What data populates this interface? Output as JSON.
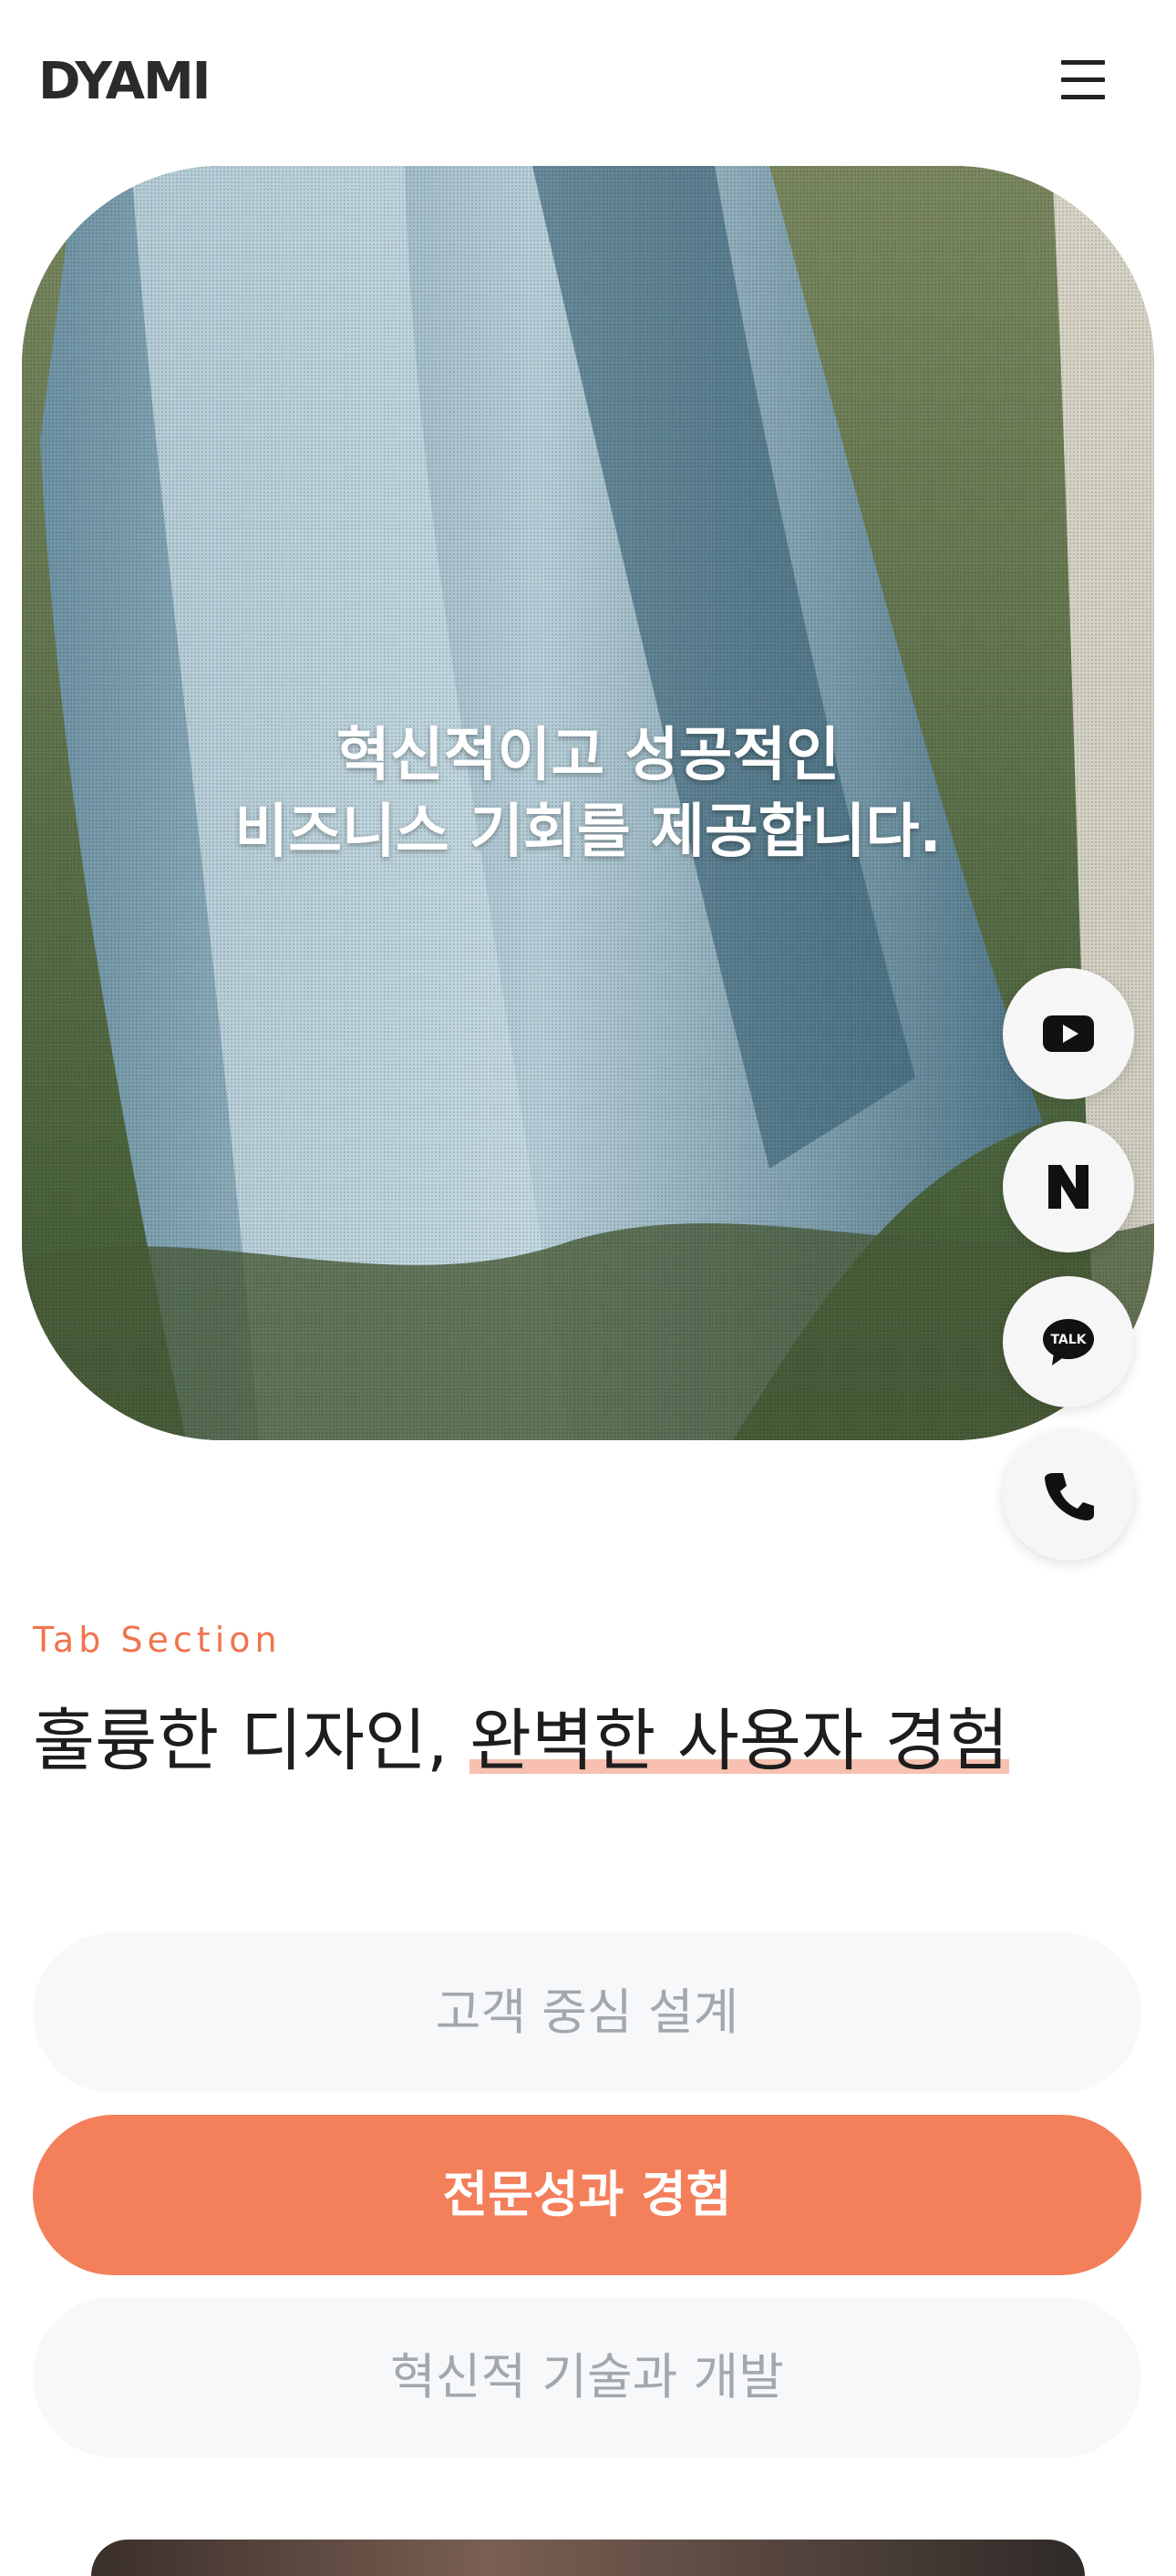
{
  "header": {
    "logo": "DYAMI",
    "menu_icon": "hamburger-menu-icon"
  },
  "hero": {
    "title_line1": "혁신적이고 성공적인",
    "title_line2": "비즈니스 기회를 제공합니다.",
    "slides_total": 2,
    "active_slide": 2
  },
  "floating_buttons": [
    {
      "icon": "youtube-icon"
    },
    {
      "icon": "naver-icon",
      "glyph": "N"
    },
    {
      "icon": "kakaotalk-icon",
      "glyph": "TALK"
    },
    {
      "icon": "phone-icon"
    }
  ],
  "section": {
    "eyebrow": "Tab Section",
    "title_plain": "훌륭한 디자인, ",
    "title_highlight": "완벽한 사용자 경험"
  },
  "tabs": [
    {
      "label": "고객 중심 설계",
      "active": false
    },
    {
      "label": "전문성과 경험",
      "active": true
    },
    {
      "label": "혁신적 기술과 개발",
      "active": false
    }
  ],
  "colors": {
    "accent": "#f47f5b",
    "eyebrow": "#f0744d",
    "highlight": "#f7c0b0",
    "tab_inactive_bg": "#f7f8fa",
    "tab_inactive_text": "#a3a8ae"
  }
}
